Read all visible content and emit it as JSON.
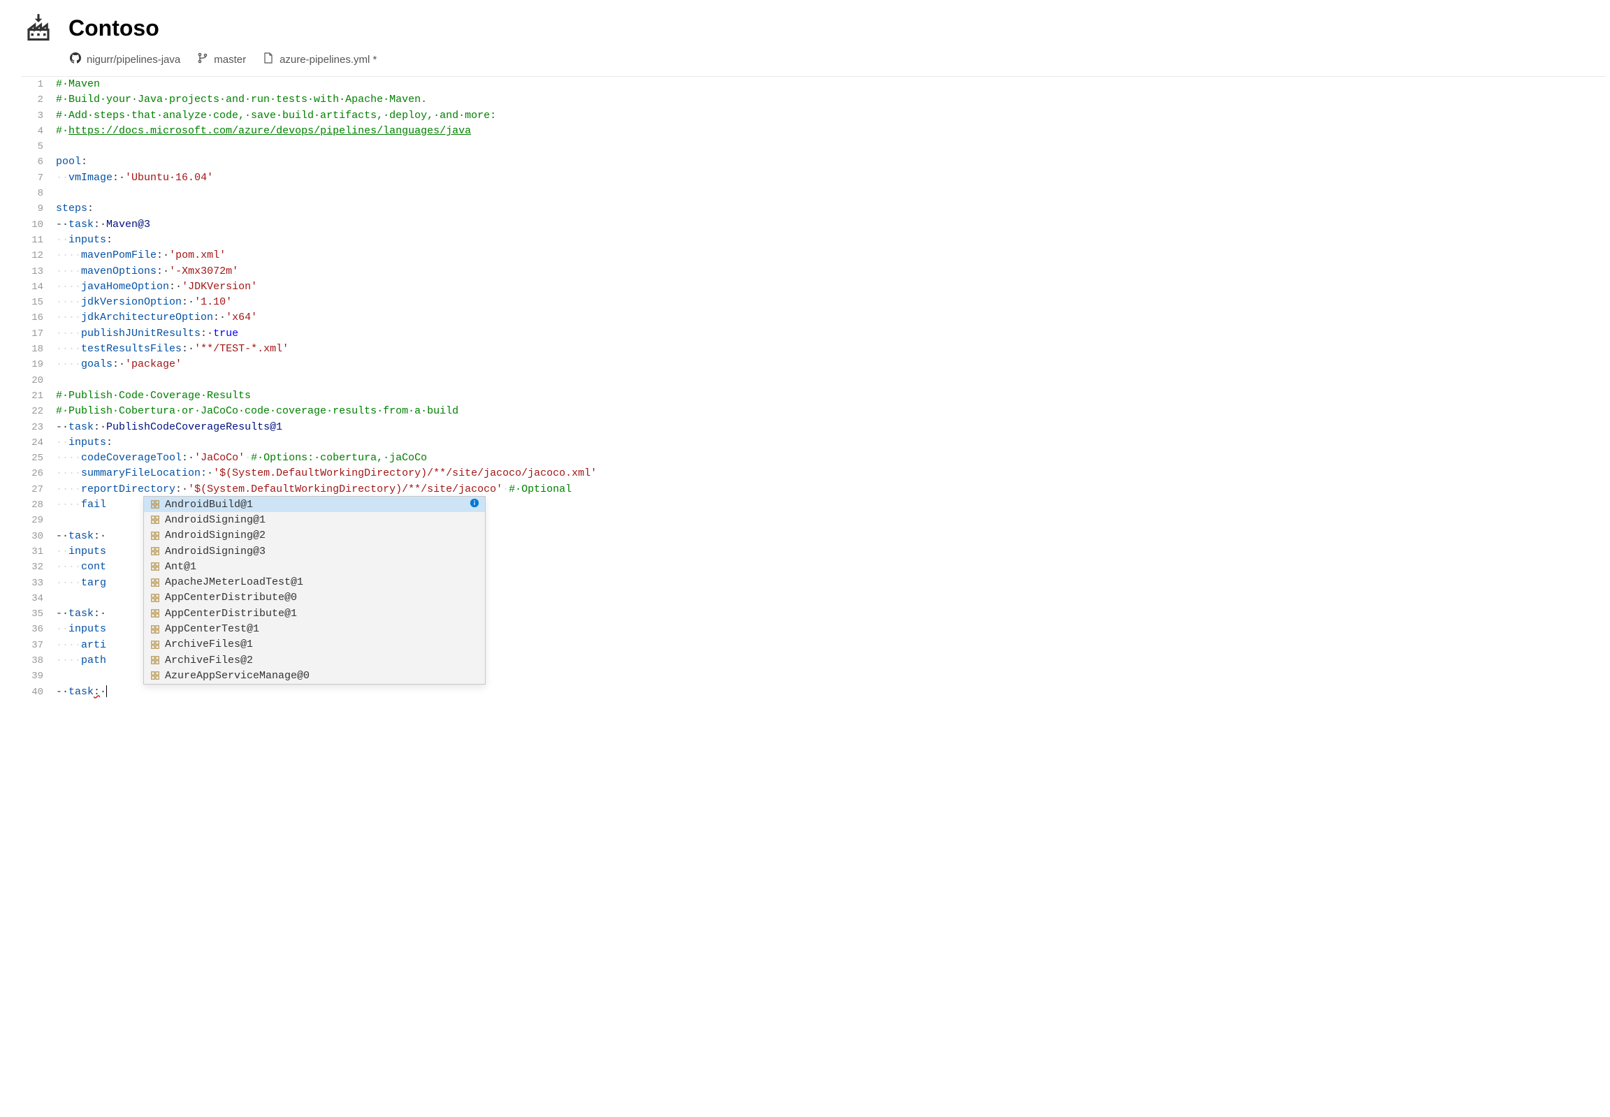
{
  "header": {
    "title": "Contoso"
  },
  "breadcrumb": {
    "repo": "nigurr/pipelines-java",
    "branch": "master",
    "file": "azure-pipelines.yml *"
  },
  "code": {
    "lines": [
      {
        "n": 1,
        "segs": [
          {
            "t": "#·Maven",
            "cls": "tok-comment"
          }
        ]
      },
      {
        "n": 2,
        "segs": [
          {
            "t": "#·Build·your·Java·projects·and·run·tests·with·Apache·Maven.",
            "cls": "tok-comment"
          }
        ]
      },
      {
        "n": 3,
        "segs": [
          {
            "t": "#·Add·steps·that·analyze·code,·save·build·artifacts,·deploy,·and·more:",
            "cls": "tok-comment"
          }
        ]
      },
      {
        "n": 4,
        "segs": [
          {
            "t": "#·",
            "cls": "tok-comment"
          },
          {
            "t": "https://docs.microsoft.com/azure/devops/pipelines/languages/java",
            "cls": "tok-link"
          }
        ]
      },
      {
        "n": 5,
        "segs": []
      },
      {
        "n": 6,
        "segs": [
          {
            "t": "pool",
            "cls": "tok-key"
          },
          {
            "t": ":",
            "cls": "tok-plain"
          }
        ]
      },
      {
        "n": 7,
        "segs": [
          {
            "t": "··",
            "cls": "ws"
          },
          {
            "t": "vmImage",
            "cls": "tok-key"
          },
          {
            "t": ":·",
            "cls": "tok-plain"
          },
          {
            "t": "'Ubuntu·16.04'",
            "cls": "tok-str"
          }
        ]
      },
      {
        "n": 8,
        "segs": []
      },
      {
        "n": 9,
        "segs": [
          {
            "t": "steps",
            "cls": "tok-key"
          },
          {
            "t": ":",
            "cls": "tok-plain"
          }
        ]
      },
      {
        "n": 10,
        "segs": [
          {
            "t": "-·",
            "cls": "tok-plain"
          },
          {
            "t": "task",
            "cls": "tok-key"
          },
          {
            "t": ":·",
            "cls": "tok-plain"
          },
          {
            "t": "Maven@3",
            "cls": "tok-task"
          }
        ]
      },
      {
        "n": 11,
        "segs": [
          {
            "t": "··",
            "cls": "ws"
          },
          {
            "t": "inputs",
            "cls": "tok-key"
          },
          {
            "t": ":",
            "cls": "tok-plain"
          }
        ]
      },
      {
        "n": 12,
        "segs": [
          {
            "t": "····",
            "cls": "ws"
          },
          {
            "t": "mavenPomFile",
            "cls": "tok-key"
          },
          {
            "t": ":·",
            "cls": "tok-plain"
          },
          {
            "t": "'pom.xml'",
            "cls": "tok-str"
          }
        ]
      },
      {
        "n": 13,
        "segs": [
          {
            "t": "····",
            "cls": "ws"
          },
          {
            "t": "mavenOptions",
            "cls": "tok-key"
          },
          {
            "t": ":·",
            "cls": "tok-plain"
          },
          {
            "t": "'-Xmx3072m'",
            "cls": "tok-str"
          }
        ]
      },
      {
        "n": 14,
        "segs": [
          {
            "t": "····",
            "cls": "ws"
          },
          {
            "t": "javaHomeOption",
            "cls": "tok-key"
          },
          {
            "t": ":·",
            "cls": "tok-plain"
          },
          {
            "t": "'JDKVersion'",
            "cls": "tok-str"
          }
        ]
      },
      {
        "n": 15,
        "segs": [
          {
            "t": "····",
            "cls": "ws"
          },
          {
            "t": "jdkVersionOption",
            "cls": "tok-key"
          },
          {
            "t": ":·",
            "cls": "tok-plain"
          },
          {
            "t": "'1.10'",
            "cls": "tok-str"
          }
        ]
      },
      {
        "n": 16,
        "segs": [
          {
            "t": "····",
            "cls": "ws"
          },
          {
            "t": "jdkArchitectureOption",
            "cls": "tok-key"
          },
          {
            "t": ":·",
            "cls": "tok-plain"
          },
          {
            "t": "'x64'",
            "cls": "tok-str"
          }
        ]
      },
      {
        "n": 17,
        "segs": [
          {
            "t": "····",
            "cls": "ws"
          },
          {
            "t": "publishJUnitResults",
            "cls": "tok-key"
          },
          {
            "t": ":·",
            "cls": "tok-plain"
          },
          {
            "t": "true",
            "cls": "tok-bool"
          }
        ]
      },
      {
        "n": 18,
        "segs": [
          {
            "t": "····",
            "cls": "ws"
          },
          {
            "t": "testResultsFiles",
            "cls": "tok-key"
          },
          {
            "t": ":·",
            "cls": "tok-plain"
          },
          {
            "t": "'**/TEST-*.xml'",
            "cls": "tok-str"
          }
        ]
      },
      {
        "n": 19,
        "segs": [
          {
            "t": "····",
            "cls": "ws"
          },
          {
            "t": "goals",
            "cls": "tok-key"
          },
          {
            "t": ":·",
            "cls": "tok-plain"
          },
          {
            "t": "'package'",
            "cls": "tok-str"
          }
        ]
      },
      {
        "n": 20,
        "segs": []
      },
      {
        "n": 21,
        "segs": [
          {
            "t": "#·Publish·Code·Coverage·Results",
            "cls": "tok-comment"
          }
        ]
      },
      {
        "n": 22,
        "segs": [
          {
            "t": "#·Publish·Cobertura·or·JaCoCo·code·coverage·results·from·a·build",
            "cls": "tok-comment"
          }
        ]
      },
      {
        "n": 23,
        "segs": [
          {
            "t": "-·",
            "cls": "tok-plain"
          },
          {
            "t": "task",
            "cls": "tok-key"
          },
          {
            "t": ":·",
            "cls": "tok-plain"
          },
          {
            "t": "PublishCodeCoverageResults@1",
            "cls": "tok-task"
          }
        ]
      },
      {
        "n": 24,
        "segs": [
          {
            "t": "··",
            "cls": "ws"
          },
          {
            "t": "inputs",
            "cls": "tok-key"
          },
          {
            "t": ":",
            "cls": "tok-plain"
          }
        ]
      },
      {
        "n": 25,
        "segs": [
          {
            "t": "····",
            "cls": "ws"
          },
          {
            "t": "codeCoverageTool",
            "cls": "tok-key"
          },
          {
            "t": ":·",
            "cls": "tok-plain"
          },
          {
            "t": "'JaCoCo'",
            "cls": "tok-str"
          },
          {
            "t": "·",
            "cls": "ws"
          },
          {
            "t": "#·Options:·cobertura,·jaCoCo",
            "cls": "tok-comment"
          }
        ]
      },
      {
        "n": 26,
        "segs": [
          {
            "t": "····",
            "cls": "ws"
          },
          {
            "t": "summaryFileLocation",
            "cls": "tok-key"
          },
          {
            "t": ":·",
            "cls": "tok-plain"
          },
          {
            "t": "'$(System.DefaultWorkingDirectory)/**/site/jacoco/jacoco.xml'",
            "cls": "tok-str"
          }
        ]
      },
      {
        "n": 27,
        "segs": [
          {
            "t": "····",
            "cls": "ws"
          },
          {
            "t": "reportDirectory",
            "cls": "tok-key"
          },
          {
            "t": ":·",
            "cls": "tok-plain"
          },
          {
            "t": "'$(System.DefaultWorkingDirectory)/**/site/jacoco'",
            "cls": "tok-str"
          },
          {
            "t": "·",
            "cls": "ws"
          },
          {
            "t": "#·Optional",
            "cls": "tok-comment"
          }
        ]
      },
      {
        "n": 28,
        "segs": [
          {
            "t": "····",
            "cls": "ws"
          },
          {
            "t": "fail",
            "cls": "tok-key"
          }
        ]
      },
      {
        "n": 29,
        "segs": []
      },
      {
        "n": 30,
        "segs": [
          {
            "t": "-·",
            "cls": "tok-plain"
          },
          {
            "t": "task",
            "cls": "tok-key"
          },
          {
            "t": ":·",
            "cls": "tok-plain"
          }
        ]
      },
      {
        "n": 31,
        "segs": [
          {
            "t": "··",
            "cls": "ws"
          },
          {
            "t": "inputs",
            "cls": "tok-key"
          }
        ]
      },
      {
        "n": 32,
        "segs": [
          {
            "t": "····",
            "cls": "ws"
          },
          {
            "t": "cont",
            "cls": "tok-key"
          }
        ]
      },
      {
        "n": 33,
        "segs": [
          {
            "t": "····",
            "cls": "ws"
          },
          {
            "t": "targ",
            "cls": "tok-key"
          }
        ]
      },
      {
        "n": 34,
        "segs": []
      },
      {
        "n": 35,
        "segs": [
          {
            "t": "-·",
            "cls": "tok-plain"
          },
          {
            "t": "task",
            "cls": "tok-key"
          },
          {
            "t": ":·",
            "cls": "tok-plain"
          }
        ]
      },
      {
        "n": 36,
        "segs": [
          {
            "t": "··",
            "cls": "ws"
          },
          {
            "t": "inputs",
            "cls": "tok-key"
          }
        ]
      },
      {
        "n": 37,
        "segs": [
          {
            "t": "····",
            "cls": "ws"
          },
          {
            "t": "arti",
            "cls": "tok-key"
          }
        ]
      },
      {
        "n": 38,
        "segs": [
          {
            "t": "····",
            "cls": "ws"
          },
          {
            "t": "path",
            "cls": "tok-key"
          }
        ]
      },
      {
        "n": 39,
        "segs": []
      },
      {
        "n": 40,
        "segs": [
          {
            "t": "-·",
            "cls": "tok-plain"
          },
          {
            "t": "task",
            "cls": "tok-key"
          },
          {
            "t": ":",
            "cls": "squiggle"
          },
          {
            "t": "·",
            "cls": "tok-plain"
          }
        ]
      }
    ]
  },
  "autocomplete": {
    "items": [
      {
        "label": "AndroidBuild@1",
        "selected": true
      },
      {
        "label": "AndroidSigning@1",
        "selected": false
      },
      {
        "label": "AndroidSigning@2",
        "selected": false
      },
      {
        "label": "AndroidSigning@3",
        "selected": false
      },
      {
        "label": "Ant@1",
        "selected": false
      },
      {
        "label": "ApacheJMeterLoadTest@1",
        "selected": false
      },
      {
        "label": "AppCenterDistribute@0",
        "selected": false
      },
      {
        "label": "AppCenterDistribute@1",
        "selected": false
      },
      {
        "label": "AppCenterTest@1",
        "selected": false
      },
      {
        "label": "ArchiveFiles@1",
        "selected": false
      },
      {
        "label": "ArchiveFiles@2",
        "selected": false
      },
      {
        "label": "AzureAppServiceManage@0",
        "selected": false
      }
    ]
  }
}
